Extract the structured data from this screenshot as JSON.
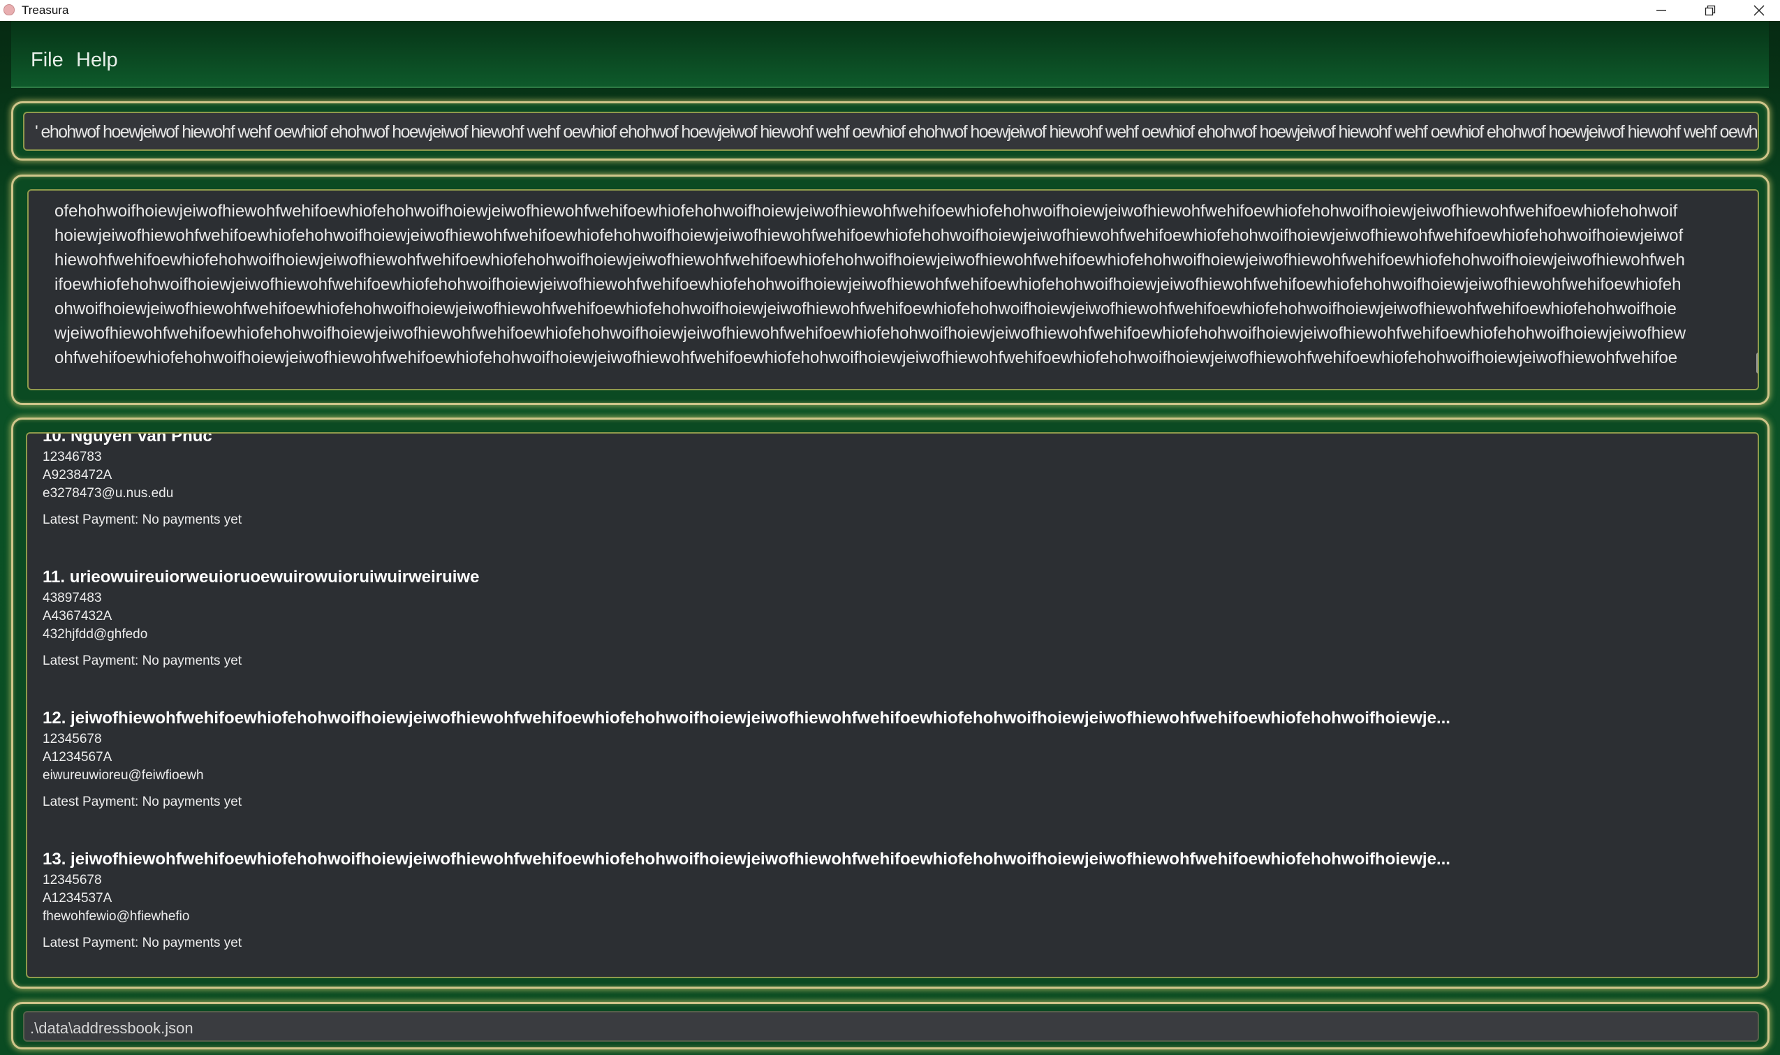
{
  "window": {
    "title": "Treasura"
  },
  "menu": {
    "file": "File",
    "help": "Help"
  },
  "command_box": {
    "value": "' ehohwof hoewjeiwof hiewohf wehf oewhiof ehohwof hoewjeiwof hiewohf wehf oewhiof ehohwof hoewjeiwof hiewohf wehf oewhiof ehohwof hoewjeiwof hiewohf wehf oewhiof ehohwof hoewjeiwof hiewohf wehf oewhiof ehohwof hoewjeiwof hiewohf wehf oewhiof ehohwof hoewjeiwof hiew"
  },
  "result_display": {
    "lines": [
      "ofehohwoifhoiewjeiwofhiewohfwehifoewhiofehohwoifhoiewjeiwofhiewohfwehifoewhiofehohwoifhoiewjeiwofhiewohfwehifoewhiofehohwoifhoiewjeiwofhiewohfwehifoewhiofehohwoifhoiewjeiwofhiewohfwehifoewhiofehohwoif",
      "hoiewjeiwofhiewohfwehifoewhiofehohwoifhoiewjeiwofhiewohfwehifoewhiofehohwoifhoiewjeiwofhiewohfwehifoewhiofehohwoifhoiewjeiwofhiewohfwehifoewhiofehohwoifhoiewjeiwofhiewohfwehifoewhiofehohwoifhoiewjeiwof",
      "hiewohfwehifoewhiofehohwoifhoiewjeiwofhiewohfwehifoewhiofehohwoifhoiewjeiwofhiewohfwehifoewhiofehohwoifhoiewjeiwofhiewohfwehifoewhiofehohwoifhoiewjeiwofhiewohfwehifoewhiofehohwoifhoiewjeiwofhiewohfweh",
      "ifoewhiofehohwoifhoiewjeiwofhiewohfwehifoewhiofehohwoifhoiewjeiwofhiewohfwehifoewhiofehohwoifhoiewjeiwofhiewohfwehifoewhiofehohwoifhoiewjeiwofhiewohfwehifoewhiofehohwoifhoiewjeiwofhiewohfwehifoewhiofeh",
      "ohwoifhoiewjeiwofhiewohfwehifoewhiofehohwoifhoiewjeiwofhiewohfwehifoewhiofehohwoifhoiewjeiwofhiewohfwehifoewhiofehohwoifhoiewjeiwofhiewohfwehifoewhiofehohwoifhoiewjeiwofhiewohfwehifoewhiofehohwoifhoie",
      "wjeiwofhiewohfwehifoewhiofehohwoifhoiewjeiwofhiewohfwehifoewhiofehohwoifhoiewjeiwofhiewohfwehifoewhiofehohwoifhoiewjeiwofhiewohfwehifoewhiofehohwoifhoiewjeiwofhiewohfwehifoewhiofehohwoifhoiewjeiwofhiew",
      "ohfwehifoewhiofehohwoifhoiewjeiwofhiewohfwehifoewhiofehohwoifhoiewjeiwofhiewohfwehifoewhiofehohwoifhoiewjeiwofhiewohfwehifoewhiofehohwoifhoiewjeiwofhiewohfwehifoewhiofehohwoifhoiewjeiwofhiewohfwehifoe"
    ]
  },
  "person_list": {
    "persons": [
      {
        "name": "10. Nguyen Van Phuc",
        "phone": "12346783",
        "id": "A9238472A",
        "email": "e3278473@u.nus.edu",
        "payment": "Latest Payment: No payments yet"
      },
      {
        "name": "11. urieowuireuiorweuioruoewuirowuioruiwuirweiruiwe",
        "phone": "43897483",
        "id": "A4367432A",
        "email": "432hjfdd@ghfedo",
        "payment": "Latest Payment: No payments yet"
      },
      {
        "name": "12. jeiwofhiewohfwehifoewhiofehohwoifhoiewjeiwofhiewohfwehifoewhiofehohwoifhoiewjeiwofhiewohfwehifoewhiofehohwoifhoiewjeiwofhiewohfwehifoewhiofehohwoifhoiewje...",
        "phone": "12345678",
        "id": "A1234567A",
        "email": "eiwureuwioreu@feiwfioewh",
        "payment": "Latest Payment: No payments yet"
      },
      {
        "name": "13. jeiwofhiewohfwehifoewhiofehohwoifhoiewjeiwofhiewohfwehifoewhiofehohwoifhoiewjeiwofhiewohfwehifoewhiofehohwoifhoiewjeiwofhiewohfwehifoewhiofehohwoifhoiewje...",
        "phone": "12345678",
        "id": "A1234537A",
        "email": "fhewohfewio@hfiewhefio",
        "payment": "Latest Payment: No payments yet"
      }
    ]
  },
  "status_bar": {
    "file_path": ".\\data\\addressbook.json"
  },
  "colors": {
    "background_green": "#0b4a22",
    "panel_border_gold": "#cfc58a",
    "panel_inner": "#2c2f33"
  }
}
